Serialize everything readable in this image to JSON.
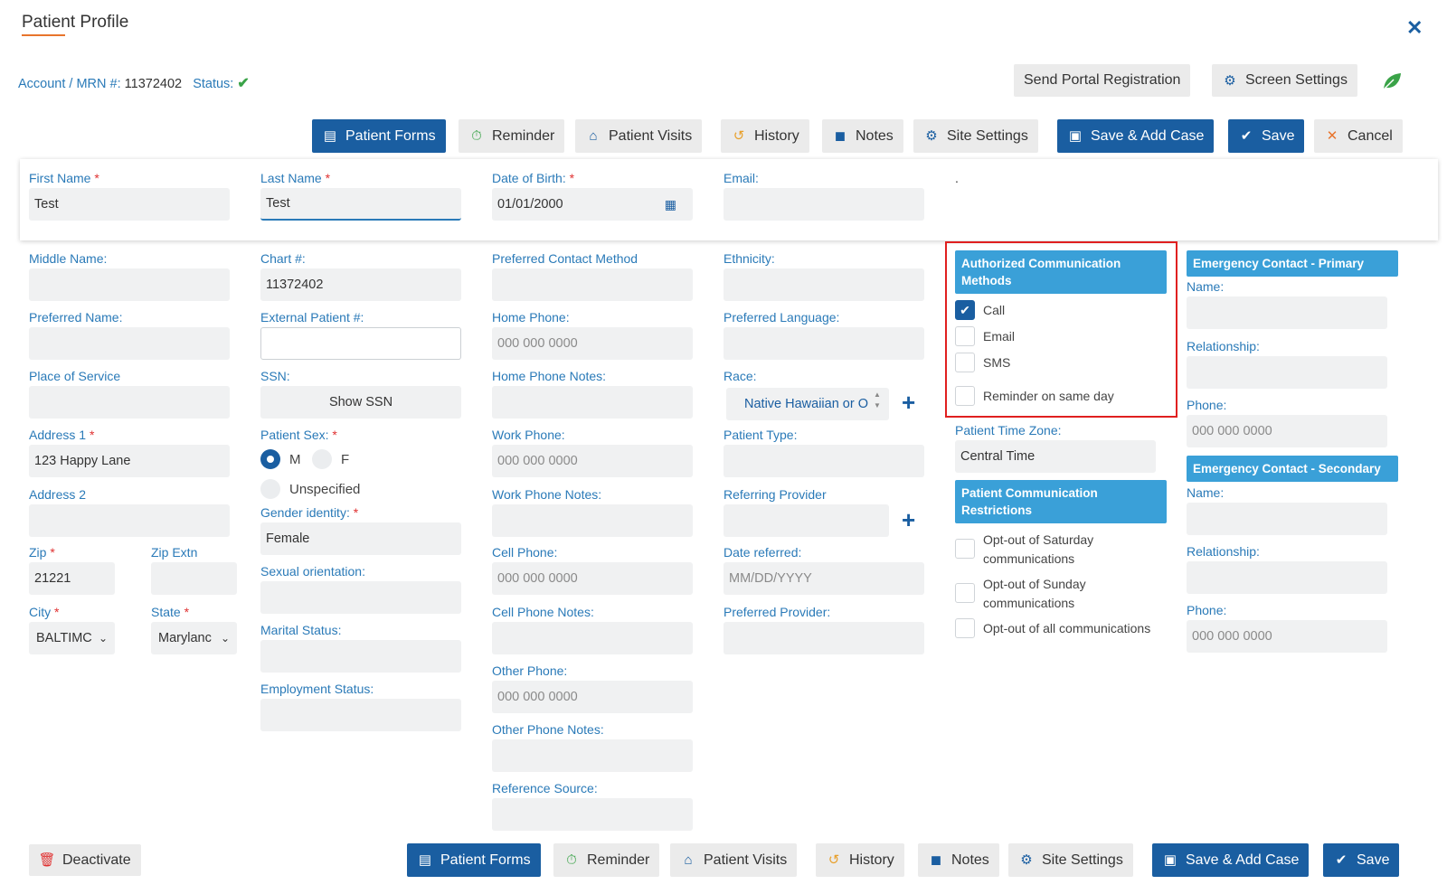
{
  "header": {
    "title": "Patient Profile",
    "account_label": "Account / MRN #:",
    "account_value": "11372402",
    "status_label": "Status:",
    "status_icon": "check-icon",
    "send_portal": "Send Portal Registration",
    "screen_settings": "Screen Settings"
  },
  "toolbar": {
    "patient_forms": "Patient Forms",
    "reminder": "Reminder",
    "patient_visits": "Patient Visits",
    "history": "History",
    "notes": "Notes",
    "site_settings": "Site Settings",
    "save_add_case": "Save & Add Case",
    "save": "Save",
    "cancel": "Cancel"
  },
  "footer": {
    "deactivate": "Deactivate"
  },
  "colors": {
    "primary": "#1a5ea1",
    "label": "#2a7ab8",
    "section_header": "#3aa0d8",
    "required": "#e03131",
    "highlight": "#e02020",
    "accent_underline": "#e8742c"
  },
  "top_card": {
    "first_name_label": "First Name",
    "first_name": "Test",
    "last_name_label": "Last Name",
    "last_name": "Test",
    "dob_label": "Date of Birth:",
    "dob": "01/01/2000",
    "email_label": "Email:",
    "email": "",
    "dot": "."
  },
  "col1": {
    "middle_name_label": "Middle Name:",
    "preferred_name_label": "Preferred Name:",
    "place_of_service_label": "Place of Service",
    "address1_label": "Address 1",
    "address1": "123 Happy Lane",
    "address2_label": "Address 2",
    "zip_label": "Zip",
    "zip": "21221",
    "zip_extn_label": "Zip Extn",
    "city_label": "City",
    "city": "BALTIMC",
    "state_label": "State",
    "state": "Marylanc"
  },
  "col2": {
    "chart_label": "Chart #:",
    "chart": "11372402",
    "external_label": "External Patient #:",
    "ssn_label": "SSN:",
    "show_ssn": "Show SSN",
    "sex_label": "Patient Sex:",
    "sex_m": "M",
    "sex_f": "F",
    "sex_unspecified": "Unspecified",
    "sex_selected": "M",
    "gender_label": "Gender identity:",
    "gender": "Female",
    "orientation_label": "Sexual orientation:",
    "marital_label": "Marital Status:",
    "employment_label": "Employment Status:"
  },
  "col3": {
    "contact_method_label": "Preferred Contact Method",
    "home_phone_label": "Home Phone:",
    "phone_placeholder": "000 000 0000",
    "home_notes_label": "Home Phone Notes:",
    "work_phone_label": "Work Phone:",
    "work_notes_label": "Work Phone Notes:",
    "cell_phone_label": "Cell Phone:",
    "cell_notes_label": "Cell Phone Notes:",
    "other_phone_label": "Other Phone:",
    "other_notes_label": "Other Phone Notes:",
    "reference_label": "Reference Source:"
  },
  "col4": {
    "ethnicity_label": "Ethnicity:",
    "language_label": "Preferred Language:",
    "race_label": "Race:",
    "race": "Native Hawaiian or O",
    "patient_type_label": "Patient Type:",
    "referring_label": "Referring Provider",
    "date_referred_label": "Date referred:",
    "date_placeholder": "MM/DD/YYYY",
    "preferred_provider_label": "Preferred Provider:"
  },
  "col5": {
    "auth_header": "Authorized Communication Methods",
    "call": "Call",
    "email": "Email",
    "sms": "SMS",
    "reminder_same_day": "Reminder on same day",
    "checked": [
      "Call"
    ],
    "timezone_label": "Patient Time Zone:",
    "timezone": "Central Time",
    "restrictions_header": "Patient Communication Restrictions",
    "opt_sat": "Opt-out of Saturday communications",
    "opt_sun": "Opt-out of Sunday communications",
    "opt_all": "Opt-out of all communications"
  },
  "col6": {
    "primary_header": "Emergency Contact - Primary",
    "secondary_header": "Emergency Contact - Secondary",
    "name_label": "Name:",
    "relationship_label": "Relationship:",
    "phone_label": "Phone:",
    "phone_placeholder": "000 000 0000"
  }
}
